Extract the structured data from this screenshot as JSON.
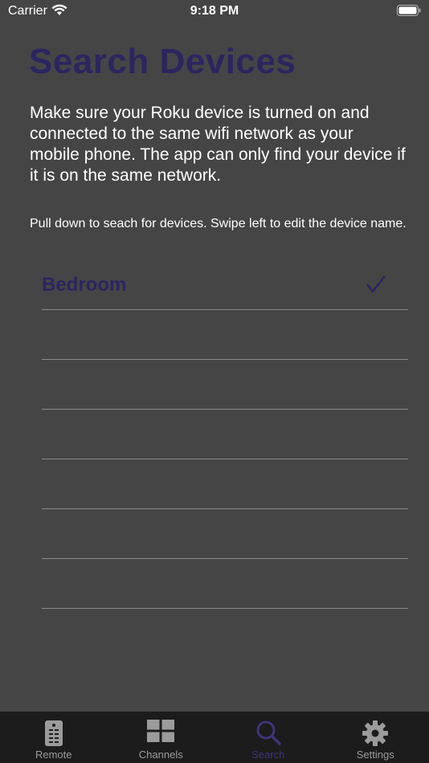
{
  "status": {
    "carrier": "Carrier",
    "time": "9:18 PM"
  },
  "page": {
    "title": "Search Devices",
    "intro": "Make sure your Roku device is turned on and connected to the same wifi network as your mobile phone. The app can only find your device if it is on the same network.",
    "hint": "Pull down to seach for devices. Swipe left to edit the device name."
  },
  "devices": [
    {
      "name": "Bedroom",
      "selected": true
    },
    {
      "name": ""
    },
    {
      "name": ""
    },
    {
      "name": ""
    },
    {
      "name": ""
    },
    {
      "name": ""
    },
    {
      "name": ""
    }
  ],
  "tabs": [
    {
      "label": "Remote",
      "icon": "remote-icon"
    },
    {
      "label": "Channels",
      "icon": "grid-icon"
    },
    {
      "label": "Search",
      "icon": "search-icon",
      "active": true
    },
    {
      "label": "Settings",
      "icon": "gear-icon"
    }
  ],
  "colors": {
    "accent": "#2b2560",
    "background": "#454545",
    "tabbar": "#1c1c1c"
  }
}
